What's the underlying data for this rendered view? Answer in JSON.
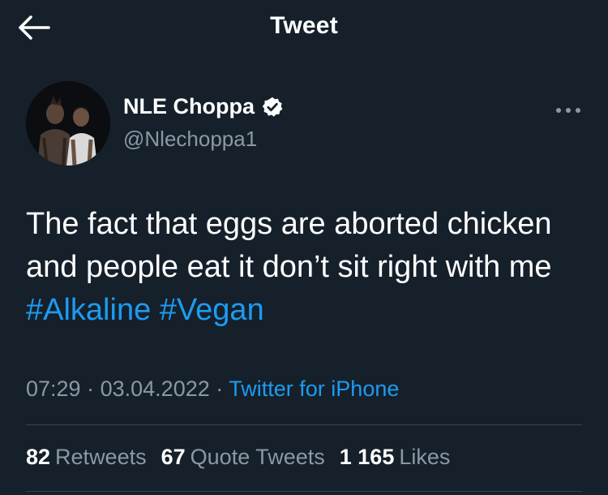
{
  "header": {
    "title": "Tweet",
    "back_icon": "arrow-left-icon"
  },
  "author": {
    "display_name": "NLE Choppa",
    "handle": "@Nlechoppa1",
    "verified_icon": "verified-badge-icon",
    "more_icon": "more-horizontal-icon"
  },
  "tweet": {
    "text_plain": "The fact that eggs are aborted chicken and people eat it don’t sit right with me",
    "hashtags": [
      "#Alkaline",
      "#Vegan"
    ]
  },
  "meta": {
    "time": "07:29",
    "separator": "·",
    "date": "03.04.2022",
    "source": "Twitter for iPhone"
  },
  "stats": {
    "retweets_count": "82",
    "retweets_label": "Retweets",
    "quotes_count": "67",
    "quotes_label": "Quote Tweets",
    "likes_count": "1 165",
    "likes_label": "Likes"
  },
  "colors": {
    "background": "#15202b",
    "accent": "#1d9bf0",
    "secondary_text": "#8b98a5",
    "divider": "#38444d"
  }
}
